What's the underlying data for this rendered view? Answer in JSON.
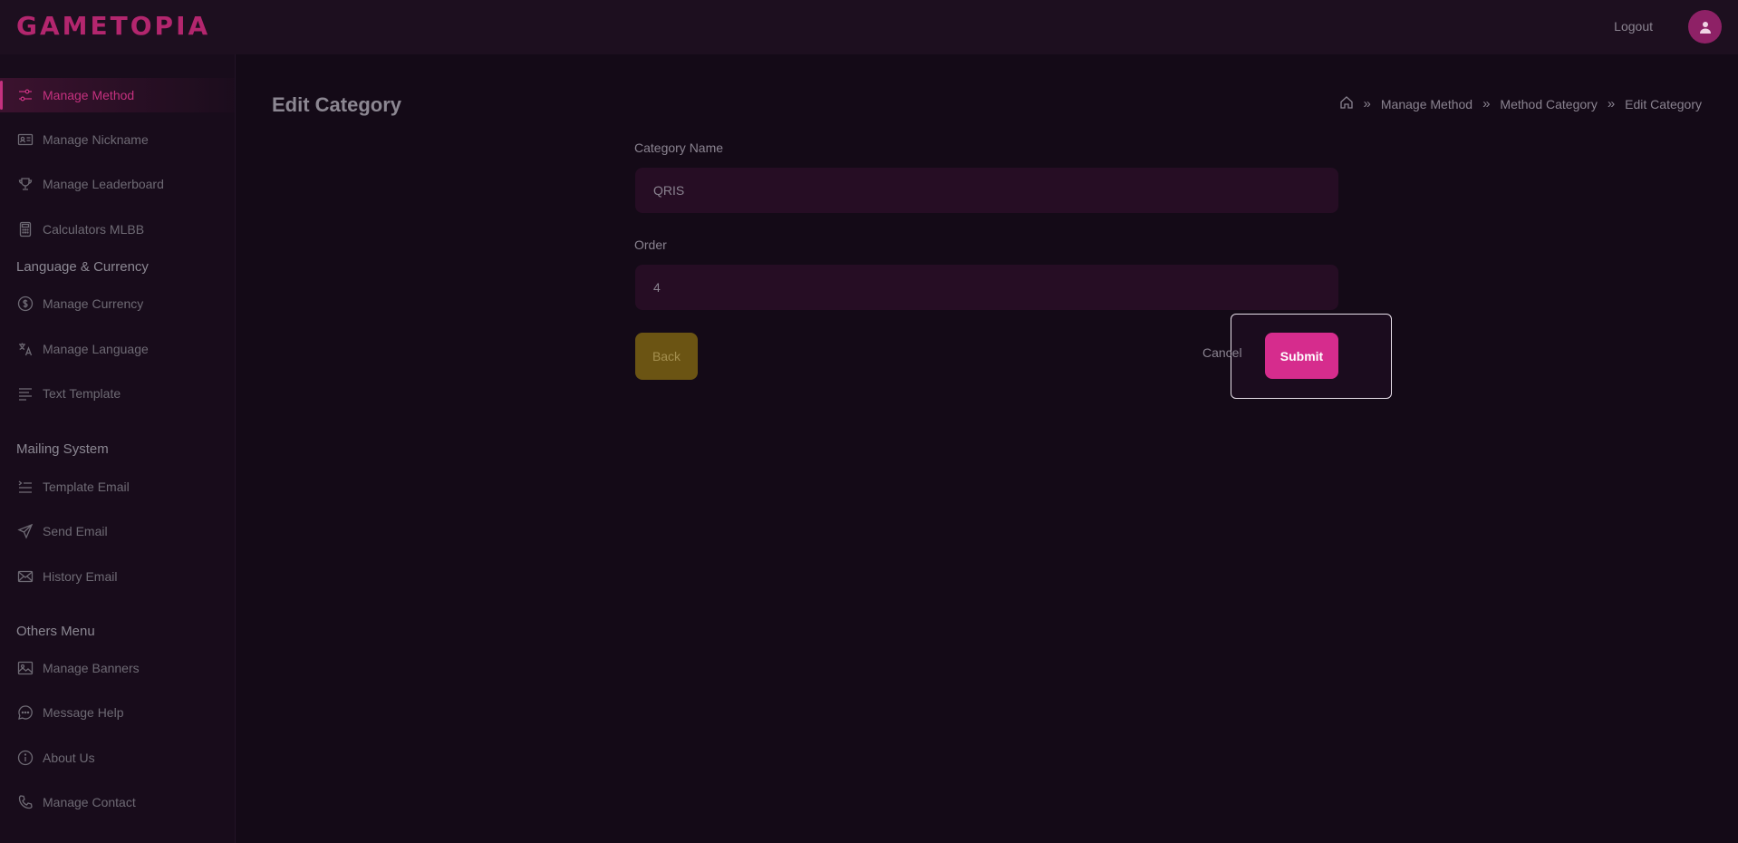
{
  "app": {
    "logo_text": "GAMETOPIA",
    "accent_color": "#c5317f"
  },
  "header": {
    "logout_label": "Logout",
    "avatar_icon": "user-icon"
  },
  "sidebar": {
    "items": [
      {
        "label": "Manage Method",
        "icon": "sliders-icon",
        "active": true
      },
      {
        "label": "Manage Nickname",
        "icon": "id-card-icon"
      },
      {
        "label": "Manage Leaderboard",
        "icon": "trophy-icon"
      },
      {
        "label": "Calculators MLBB",
        "icon": "calculator-icon"
      }
    ],
    "sections": [
      {
        "heading": "Language & Currency",
        "items": [
          {
            "label": "Manage Currency",
            "icon": "dollar-icon"
          },
          {
            "label": "Manage Language",
            "icon": "translate-icon"
          },
          {
            "label": "Text Template",
            "icon": "text-lines-icon"
          }
        ]
      },
      {
        "heading": "Mailing System",
        "items": [
          {
            "label": "Template Email",
            "icon": "list-indent-icon"
          },
          {
            "label": "Send Email",
            "icon": "send-icon"
          },
          {
            "label": "History Email",
            "icon": "envelope-icon"
          }
        ]
      },
      {
        "heading": "Others Menu",
        "items": [
          {
            "label": "Manage Banners",
            "icon": "image-icon"
          },
          {
            "label": "Message Help",
            "icon": "chat-icon"
          },
          {
            "label": "About Us",
            "icon": "info-icon"
          },
          {
            "label": "Manage Contact",
            "icon": "phone-icon"
          }
        ]
      }
    ]
  },
  "page": {
    "title": "Edit Category",
    "breadcrumb": [
      "Manage Method",
      "Method Category",
      "Edit Category"
    ]
  },
  "form": {
    "category_name_label": "Category Name",
    "category_name_value": "QRIS",
    "order_label": "Order",
    "order_value": "4",
    "back_label": "Back",
    "cancel_label": "Cancel",
    "submit_label": "Submit"
  }
}
